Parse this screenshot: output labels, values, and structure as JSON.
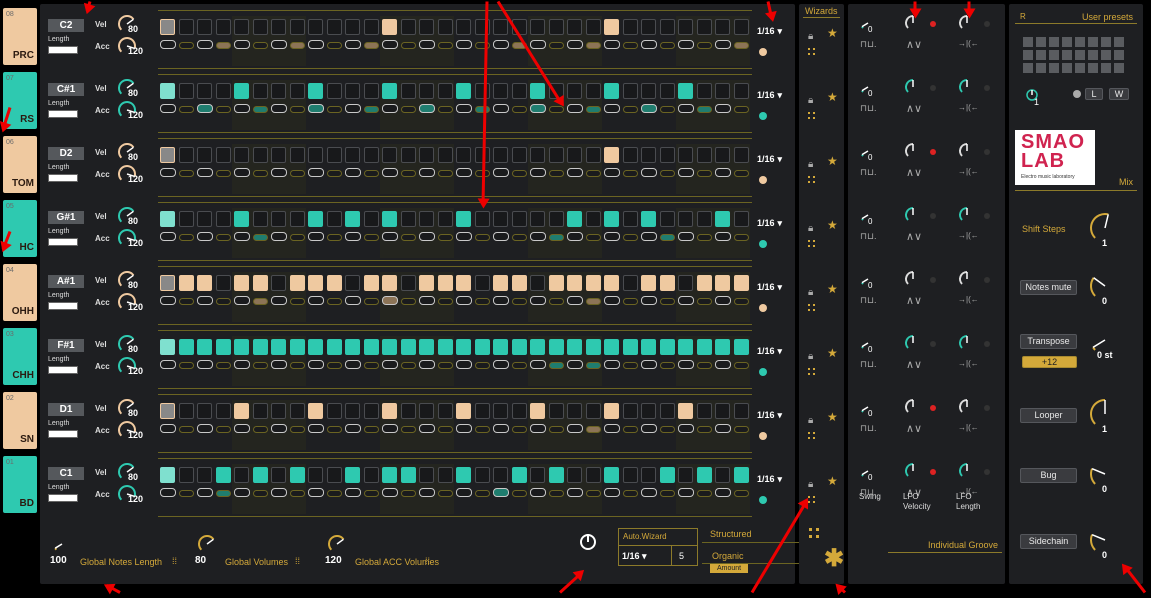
{
  "tracks": [
    {
      "num": "08",
      "name": "PRC",
      "color": "#efc9a0"
    },
    {
      "num": "07",
      "name": "RS",
      "color": "#2ec9b0"
    },
    {
      "num": "06",
      "name": "TOM",
      "color": "#efc9a0"
    },
    {
      "num": "05",
      "name": "HC",
      "color": "#2ec9b0"
    },
    {
      "num": "04",
      "name": "OHH",
      "color": "#efc9a0"
    },
    {
      "num": "03",
      "name": "CHH",
      "color": "#2ec9b0"
    },
    {
      "num": "02",
      "name": "SN",
      "color": "#efc9a0"
    },
    {
      "num": "01",
      "name": "BD",
      "color": "#2ec9b0"
    }
  ],
  "labels": {
    "length": "Length",
    "vel": "Vel",
    "acc": "Acc"
  },
  "rows": [
    {
      "note": "C2",
      "vel": "80",
      "acc": "120",
      "rate": "1/16",
      "color": "#efc9a0",
      "dim": "#8c7456",
      "steps": "1000000000001000000000001000000000001000000000001000",
      "accents": "0001000100010000000100010000000100010001000100010000"
    },
    {
      "note": "C#1",
      "vel": "80",
      "acc": "120",
      "rate": "1/16",
      "color": "#2ec9b0",
      "dim": "#1f7d6f",
      "steps": "1000100010001000100010001000100010001000100000000000",
      "accents": "0010010010010010010010010010010010010010010010010111"
    },
    {
      "note": "D2",
      "vel": "80",
      "acc": "120",
      "rate": "1/16",
      "color": "#efc9a0",
      "dim": "#8c7456",
      "steps": "1000000000000000000000001000000000000000000000001000",
      "accents": "0000000000000000000000000000000000000000000000000000"
    },
    {
      "note": "G#1",
      "vel": "80",
      "acc": "120",
      "rate": "1/16",
      "color": "#2ec9b0",
      "dim": "#1f7d6f",
      "steps": "1000100010101000100000101010001010101000101010001000",
      "accents": "0000010000000000000001000001000000010000010000000000"
    },
    {
      "note": "A#1",
      "vel": "80",
      "acc": "120",
      "rate": "1/16",
      "color": "#efc9a0",
      "dim": "#8c7456",
      "steps": "1110110111011011101101111011011110110111011011111011",
      "accents": "0000010000001000000000010000000000001000000010000000"
    },
    {
      "note": "F#1",
      "vel": "80",
      "acc": "120",
      "rate": "1/16",
      "color": "#2ec9b0",
      "dim": "#1f7d6f",
      "steps": "1111111111111111111111111111111111111111111111111111",
      "accents": "0000000000000000000001010000000000000000000000000100"
    },
    {
      "note": "D1",
      "vel": "80",
      "acc": "120",
      "rate": "1/16",
      "color": "#efc9a0",
      "dim": "#8c7456",
      "steps": "1000100010001000100010001000100010001000100010001000",
      "accents": "0000000000000000000000010000000000000000000000010000"
    },
    {
      "note": "C1",
      "vel": "80",
      "acc": "120",
      "rate": "1/16",
      "color": "#2ec9b0",
      "dim": "#1f7d6f",
      "steps": "1001010100101100100101001001010100101010010110010100",
      "accents": "0001000000000000001000000000000010000000010000000000"
    }
  ],
  "globals": [
    {
      "value": "100",
      "label": "Global Notes Length"
    },
    {
      "value": "80",
      "label": "Global Volumes"
    },
    {
      "value": "120",
      "label": "Global ACC Volumes"
    }
  ],
  "autowizard": {
    "title": "Auto.Wizard",
    "rate": "1/16",
    "count": "5",
    "structured": "Structured",
    "organic": "Organic",
    "amount": "Amount"
  },
  "wizards": {
    "title": "Wizards"
  },
  "groove": {
    "swing_value": "0",
    "swing_label": "Swing",
    "lfo_vel_label": "LFO\nVelocity",
    "lfo_len_label": "LFO\nLength",
    "title": "Individual Groove"
  },
  "presets": {
    "r": "R",
    "title": "User presets",
    "knob_value": "1",
    "l": "L",
    "w": "W"
  },
  "logo": {
    "line1": "SMAO",
    "line2": "LAB",
    "sub": "Electro music laboratory",
    "mix": "Mix"
  },
  "mix": [
    {
      "label": "Shift Steps",
      "value": "1",
      "boxed": false
    },
    {
      "label": "Notes mute",
      "value": "0",
      "boxed": true
    },
    {
      "label": "Transpose",
      "value": "0 st",
      "boxed": true,
      "sub": "+12"
    },
    {
      "label": "Looper",
      "value": "1",
      "boxed": true
    },
    {
      "label": "Bug",
      "value": "0",
      "boxed": true
    },
    {
      "label": "Sidechain",
      "value": "0",
      "boxed": true
    }
  ]
}
